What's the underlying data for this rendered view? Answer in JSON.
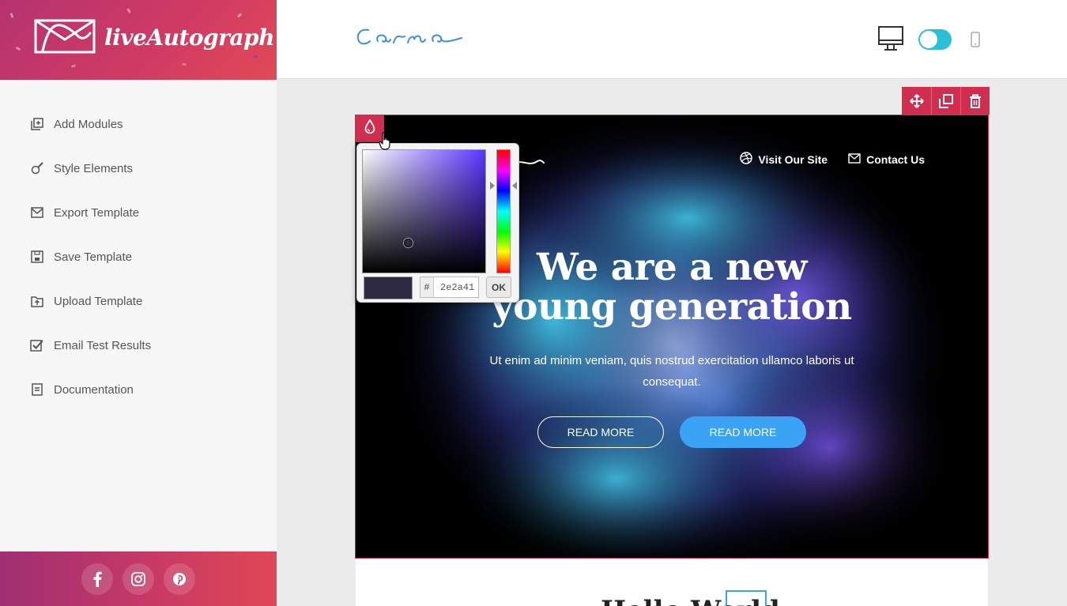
{
  "brand": {
    "name": "liveAutograph"
  },
  "sidebar": {
    "items": [
      {
        "label": "Add Modules",
        "icon": "add-modules-icon"
      },
      {
        "label": "Style Elements",
        "icon": "brush-icon"
      },
      {
        "label": "Export Template",
        "icon": "envelope-icon"
      },
      {
        "label": "Save Template",
        "icon": "save-icon"
      },
      {
        "label": "Upload Template",
        "icon": "upload-icon"
      },
      {
        "label": "Email Test Results",
        "icon": "checkbox-icon"
      },
      {
        "label": "Documentation",
        "icon": "document-icon"
      }
    ],
    "social": [
      "facebook-icon",
      "instagram-icon",
      "pinterest-icon"
    ]
  },
  "topbar": {
    "logo_text": "Carma",
    "view_mode": "desktop",
    "toggle_on": true
  },
  "hero": {
    "nav": [
      {
        "label": "Visit Our Site",
        "icon": "dribbble-icon"
      },
      {
        "label": "Contact Us",
        "icon": "envelope-icon"
      }
    ],
    "title_line1": "We are a new",
    "title_line2": "young generation",
    "subtitle": "Ut enim ad minim veniam, quis nostrud exercitation ullamco laboris ut consequat.",
    "button_outline": "READ MORE",
    "button_solid": "READ MORE"
  },
  "picker": {
    "hash": "#",
    "hex": "2e2a41",
    "ok_label": "OK",
    "selected_color": "#2e2a41",
    "hue_color": "#5a36ff"
  },
  "next_module": {
    "title": "Hello World"
  },
  "colors": {
    "accent": "#d12d4f",
    "button_blue": "#3aa3f5",
    "toggle": "#2bc0d8"
  }
}
